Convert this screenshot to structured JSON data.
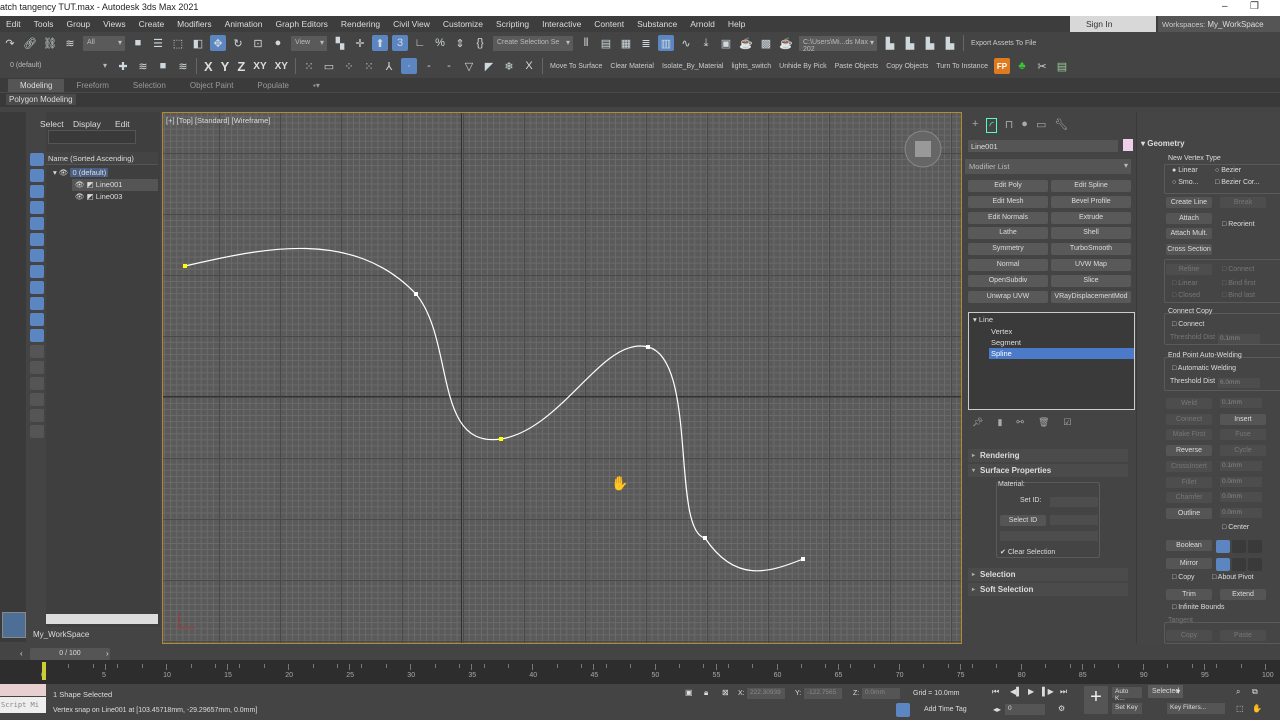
{
  "window": {
    "title": "atch tangency TUT.max - Autodesk 3ds Max 2021",
    "minimize": "–",
    "restore": "❐"
  },
  "menu": [
    "Edit",
    "Tools",
    "Group",
    "Views",
    "Create",
    "Modifiers",
    "Animation",
    "Graph Editors",
    "Rendering",
    "Civil View",
    "Customize",
    "Scripting",
    "Interactive",
    "Content",
    "Substance",
    "Arnold",
    "Help"
  ],
  "account": {
    "signin": "Sign In",
    "workspaces_label": "Workspaces:",
    "workspace": "My_WorkSpace"
  },
  "toolbar1": {
    "selection_filter": "All",
    "ref_coord": "View",
    "named_selection": "Create Selection Se",
    "project_path": "C:\\Users\\Mi...ds Max 202",
    "export": "Export Assets To File"
  },
  "toolbar2": {
    "layer": "0 (default)",
    "axes": [
      "X",
      "Y",
      "Z",
      "XY",
      "XY"
    ],
    "custom_buttons": [
      "Move To Surface",
      "Clear Material",
      "Isolate_By_Material",
      "lights_switch",
      "Unhide By Pick",
      "Paste Objects",
      "Copy Objects",
      "Turn To Instance"
    ],
    "fp": "FP"
  },
  "ribbon": {
    "tabs": [
      "Modeling",
      "Freeform",
      "Selection",
      "Object Paint",
      "Populate"
    ],
    "active": "Modeling",
    "panel": "Polygon Modeling"
  },
  "explorer": {
    "tabs": [
      "Select",
      "Display",
      "Edit"
    ],
    "column": "Name (Sorted Ascending)",
    "items": [
      {
        "label": "0 (default)"
      },
      {
        "label": "Line001"
      },
      {
        "label": "Line003"
      }
    ],
    "workspace": "My_WorkSpace"
  },
  "viewport": {
    "label": "[+] [Top] [Standard] [Wireframe]"
  },
  "command_panel": {
    "object_name": "Line001",
    "object_color": "#f0d0e8",
    "modifier_list": "Modifier List",
    "modifiers": [
      "Edit Poly",
      "Edit Spline",
      "Edit Mesh",
      "Bevel Profile",
      "Edit Normals",
      "Extrude",
      "Lathe",
      "Shell",
      "Symmetry",
      "TurboSmooth",
      "Normal",
      "UVW Map",
      "OpenSubdiv",
      "Slice",
      "Unwrap UVW",
      "VRayDisplacementMod"
    ],
    "stack": {
      "root": "Line",
      "children": [
        "Vertex",
        "Segment",
        "Spline"
      ],
      "selected": "Spline"
    },
    "rollouts": {
      "rendering": "Rendering",
      "surface": "Surface Properties",
      "material": "Material:",
      "set_id": "Set ID:",
      "select_id": "Select ID",
      "clear_selection": "Clear Selection",
      "selection": "Selection",
      "soft_selection": "Soft Selection"
    }
  },
  "geometry": {
    "title": "Geometry",
    "new_vertex_type": "New Vertex Type",
    "linear": "Linear",
    "bezier": "Bezier",
    "smooth": "Smo...",
    "bezier_corner": "Bezier Cor...",
    "create_line": "Create Line",
    "break": "Break",
    "attach": "Attach",
    "reorient": "Reorient",
    "attach_mult": "Attach Mult.",
    "cross_section": "Cross Section",
    "refine": "Refine",
    "connect": "Connect",
    "r_linear": "Linear",
    "bind_first": "Bind first",
    "closed": "Closed",
    "bind_last": "Bind last",
    "connect_copy": "Connect Copy",
    "cc_connect": "Connect",
    "threshold_dist": "Threshold Dist",
    "threshold1": "0.1mm",
    "end_point": "End Point Auto-Welding",
    "auto_weld": "Automatic Welding",
    "threshold2": "6.0mm",
    "weld": "Weld",
    "weld_val": "0.1mm",
    "connect2": "Connect",
    "insert": "Insert",
    "make_first": "Make First",
    "fuse": "Fuse",
    "reverse": "Reverse",
    "cycle": "Cycle",
    "crossinsert": "CrossInsert",
    "crossinsert_val": "0.1mm",
    "fillet": "Fillet",
    "fillet_val": "0.0mm",
    "chamfer": "Chamfer",
    "chamfer_val": "0.0mm",
    "outline": "Outline",
    "outline_val": "0.0mm",
    "center": "Center",
    "boolean": "Boolean",
    "mirror": "Mirror",
    "copy": "Copy",
    "about_pivot": "About Pivot",
    "trim": "Trim",
    "extend": "Extend",
    "infinite_bounds": "Infinite Bounds",
    "tangent": "Tangent",
    "t_copy": "Copy",
    "t_paste": "Paste"
  },
  "timeline": {
    "frame": "0 / 100",
    "ticks": [
      "0",
      "5",
      "10",
      "15",
      "20",
      "25",
      "30",
      "35",
      "40",
      "45",
      "50",
      "55",
      "60",
      "65",
      "70",
      "75",
      "80",
      "85",
      "90",
      "95",
      "100"
    ]
  },
  "status": {
    "selected": "1 Shape Selected",
    "prompt": "Vertex snap on Line001 at [103.45718mm, -29.29657mm, 0.0mm]",
    "maxscript": "Script Mi",
    "x_label": "X:",
    "x": "222.30939",
    "y_label": "Y:",
    "y": "-122.7565",
    "z_label": "Z:",
    "z": "0.0mm",
    "grid": "Grid = 10.0mm",
    "add_time_tag": "Add Time Tag",
    "current_frame": "0",
    "auto_key": "Auto K...",
    "set_key": "Set Key",
    "key_mode": "Selected",
    "key_filters": "Key Filters..."
  }
}
